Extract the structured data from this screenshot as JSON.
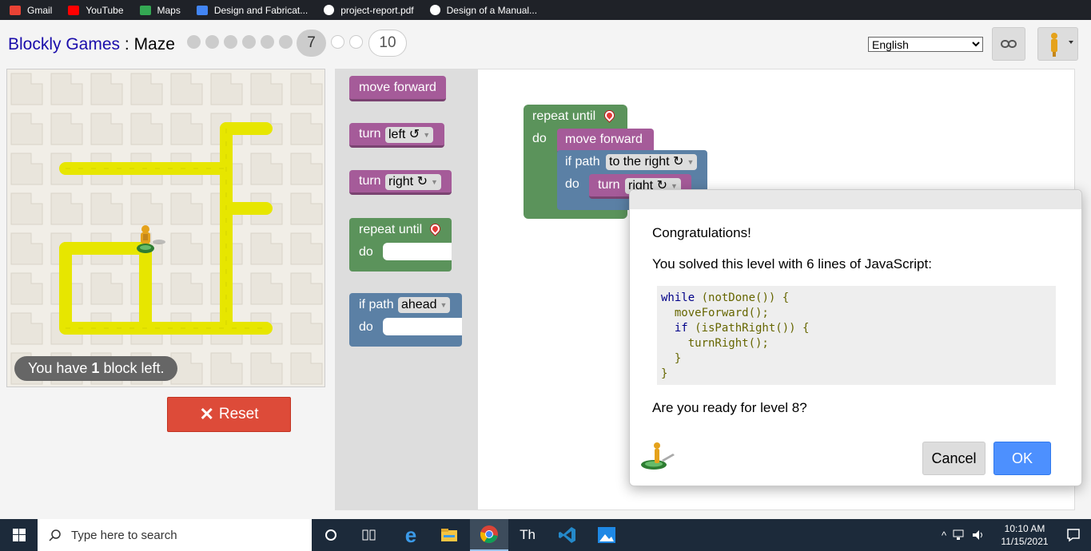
{
  "bookmarks": [
    {
      "label": "Gmail",
      "icon": "gmail-icon",
      "color": "#ea4335"
    },
    {
      "label": "YouTube",
      "icon": "youtube-icon",
      "color": "#ff0000"
    },
    {
      "label": "Maps",
      "icon": "maps-icon",
      "color": "#34a853"
    },
    {
      "label": "Design and Fabricat...",
      "icon": "site-icon",
      "color": "#4285f4"
    },
    {
      "label": "project-report.pdf",
      "icon": "globe-icon",
      "color": "#ffffff"
    },
    {
      "label": "Design of a Manual...",
      "icon": "globe-icon",
      "color": "#ffffff"
    }
  ],
  "header": {
    "title_link": "Blockly Games",
    "title_sep": " : ",
    "title_game": "Maze",
    "levels": {
      "current": "7",
      "last": "10"
    },
    "language": "English"
  },
  "maze": {
    "capacity_prefix": "You have",
    "capacity_count": "1",
    "capacity_suffix": "block left.",
    "reset_label": "Reset"
  },
  "toolbox": {
    "move_forward": "move forward",
    "turn": "turn",
    "left": "left ↺",
    "right": "right ↻",
    "repeat_until": "repeat until",
    "do": "do",
    "if_path": "if path",
    "ahead": "ahead"
  },
  "workspace": {
    "repeat_until": "repeat until",
    "do": "do",
    "move_forward": "move forward",
    "if_path": "if path",
    "to_the_right": "to the right ↻",
    "turn": "turn",
    "right": "right ↻"
  },
  "dialog": {
    "title": "Congratulations!",
    "text": "You solved this level with 6 lines of JavaScript:",
    "code": {
      "l1_kw": "while",
      "l1_rest": " (notDone()) {",
      "l2": "  moveForward();",
      "l3_kw": "  if",
      "l3_rest": " (isPathRight()) {",
      "l4": "    turnRight();",
      "l5": "  }",
      "l6": "}"
    },
    "question": "Are you ready for level 8?",
    "cancel": "Cancel",
    "ok": "OK"
  },
  "taskbar": {
    "search_placeholder": "Type here to search",
    "time": "10:10 AM",
    "date": "11/15/2021"
  },
  "colors": {
    "accent_ok": "#4d90fe",
    "reset": "#dd4b39",
    "block_purple": "#a55b99",
    "block_green": "#5b935b",
    "block_blue": "#5b80a5",
    "path_yellow": "#e7e600"
  }
}
